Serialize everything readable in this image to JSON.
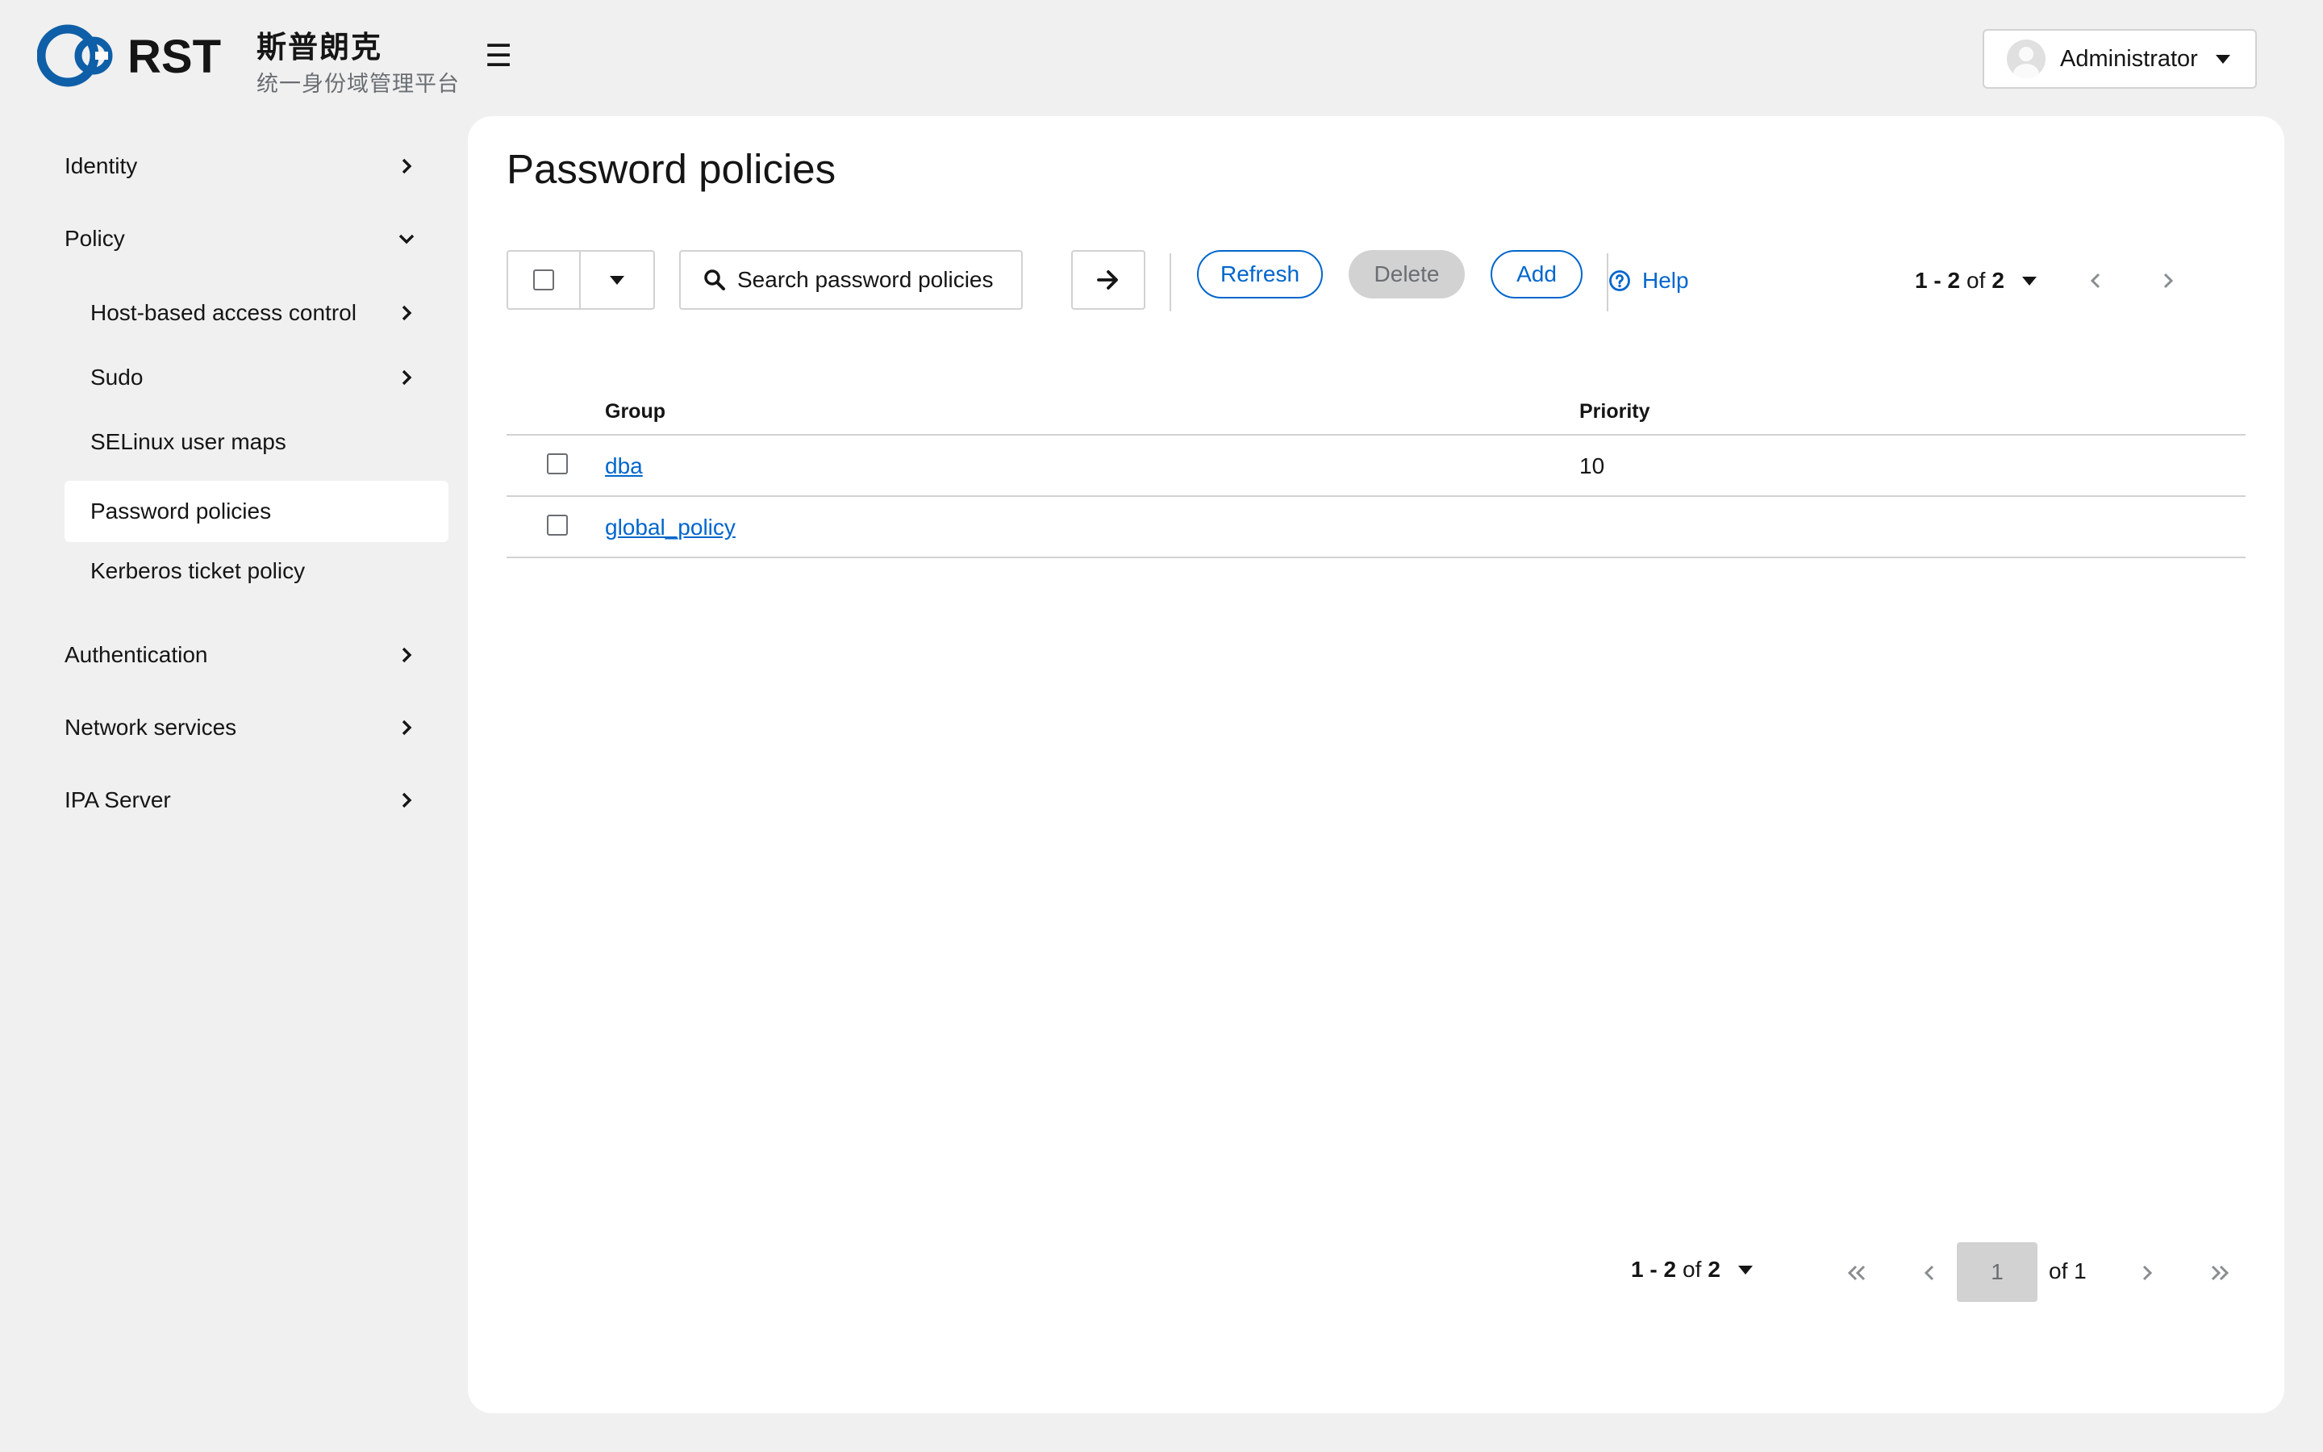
{
  "brand": {
    "logo_text": "RST",
    "name": "斯普朗克",
    "subtitle": "统一身份域管理平台"
  },
  "header": {
    "menu_icon": "hamburger-icon",
    "user_name": "Administrator"
  },
  "sidebar": {
    "items": [
      {
        "label": "Identity",
        "icon": "chevron-right-icon"
      },
      {
        "label": "Policy",
        "icon": "chevron-down-icon"
      },
      {
        "label": "Host-based access control",
        "icon": "chevron-right-icon"
      },
      {
        "label": "Sudo",
        "icon": "chevron-right-icon"
      },
      {
        "label": "SELinux user maps"
      },
      {
        "label": "Password policies",
        "active": true
      },
      {
        "label": "Kerberos ticket policy"
      },
      {
        "label": "Authentication",
        "icon": "chevron-right-icon"
      },
      {
        "label": "Network services",
        "icon": "chevron-right-icon"
      },
      {
        "label": "IPA Server",
        "icon": "chevron-right-icon"
      }
    ]
  },
  "main": {
    "title": "Password policies",
    "search_placeholder": "Search password policies",
    "refresh_label": "Refresh",
    "delete_label": "Delete",
    "add_label": "Add",
    "help_label": "Help",
    "pagination": {
      "range": "1 - 2",
      "of_label": "of",
      "total": "2",
      "page": "1",
      "page_of": "of 1"
    }
  },
  "table": {
    "columns": [
      "Group",
      "Priority"
    ],
    "rows": [
      {
        "group": "dba",
        "priority": "10"
      },
      {
        "group": "global_policy",
        "priority": ""
      }
    ]
  },
  "colors": {
    "accent": "#0066cc",
    "background": "#f0f0f0",
    "panel": "#ffffff",
    "border": "#d2d2d2"
  }
}
